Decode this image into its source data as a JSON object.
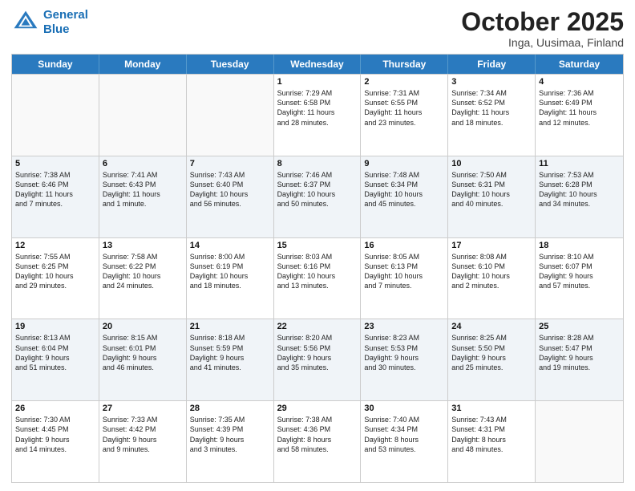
{
  "header": {
    "logo_line1": "General",
    "logo_line2": "Blue",
    "month": "October 2025",
    "location": "Inga, Uusimaa, Finland"
  },
  "weekdays": [
    "Sunday",
    "Monday",
    "Tuesday",
    "Wednesday",
    "Thursday",
    "Friday",
    "Saturday"
  ],
  "rows": [
    {
      "alt": false,
      "cells": [
        {
          "day": "",
          "info": ""
        },
        {
          "day": "",
          "info": ""
        },
        {
          "day": "",
          "info": ""
        },
        {
          "day": "1",
          "info": "Sunrise: 7:29 AM\nSunset: 6:58 PM\nDaylight: 11 hours\nand 28 minutes."
        },
        {
          "day": "2",
          "info": "Sunrise: 7:31 AM\nSunset: 6:55 PM\nDaylight: 11 hours\nand 23 minutes."
        },
        {
          "day": "3",
          "info": "Sunrise: 7:34 AM\nSunset: 6:52 PM\nDaylight: 11 hours\nand 18 minutes."
        },
        {
          "day": "4",
          "info": "Sunrise: 7:36 AM\nSunset: 6:49 PM\nDaylight: 11 hours\nand 12 minutes."
        }
      ]
    },
    {
      "alt": true,
      "cells": [
        {
          "day": "5",
          "info": "Sunrise: 7:38 AM\nSunset: 6:46 PM\nDaylight: 11 hours\nand 7 minutes."
        },
        {
          "day": "6",
          "info": "Sunrise: 7:41 AM\nSunset: 6:43 PM\nDaylight: 11 hours\nand 1 minute."
        },
        {
          "day": "7",
          "info": "Sunrise: 7:43 AM\nSunset: 6:40 PM\nDaylight: 10 hours\nand 56 minutes."
        },
        {
          "day": "8",
          "info": "Sunrise: 7:46 AM\nSunset: 6:37 PM\nDaylight: 10 hours\nand 50 minutes."
        },
        {
          "day": "9",
          "info": "Sunrise: 7:48 AM\nSunset: 6:34 PM\nDaylight: 10 hours\nand 45 minutes."
        },
        {
          "day": "10",
          "info": "Sunrise: 7:50 AM\nSunset: 6:31 PM\nDaylight: 10 hours\nand 40 minutes."
        },
        {
          "day": "11",
          "info": "Sunrise: 7:53 AM\nSunset: 6:28 PM\nDaylight: 10 hours\nand 34 minutes."
        }
      ]
    },
    {
      "alt": false,
      "cells": [
        {
          "day": "12",
          "info": "Sunrise: 7:55 AM\nSunset: 6:25 PM\nDaylight: 10 hours\nand 29 minutes."
        },
        {
          "day": "13",
          "info": "Sunrise: 7:58 AM\nSunset: 6:22 PM\nDaylight: 10 hours\nand 24 minutes."
        },
        {
          "day": "14",
          "info": "Sunrise: 8:00 AM\nSunset: 6:19 PM\nDaylight: 10 hours\nand 18 minutes."
        },
        {
          "day": "15",
          "info": "Sunrise: 8:03 AM\nSunset: 6:16 PM\nDaylight: 10 hours\nand 13 minutes."
        },
        {
          "day": "16",
          "info": "Sunrise: 8:05 AM\nSunset: 6:13 PM\nDaylight: 10 hours\nand 7 minutes."
        },
        {
          "day": "17",
          "info": "Sunrise: 8:08 AM\nSunset: 6:10 PM\nDaylight: 10 hours\nand 2 minutes."
        },
        {
          "day": "18",
          "info": "Sunrise: 8:10 AM\nSunset: 6:07 PM\nDaylight: 9 hours\nand 57 minutes."
        }
      ]
    },
    {
      "alt": true,
      "cells": [
        {
          "day": "19",
          "info": "Sunrise: 8:13 AM\nSunset: 6:04 PM\nDaylight: 9 hours\nand 51 minutes."
        },
        {
          "day": "20",
          "info": "Sunrise: 8:15 AM\nSunset: 6:01 PM\nDaylight: 9 hours\nand 46 minutes."
        },
        {
          "day": "21",
          "info": "Sunrise: 8:18 AM\nSunset: 5:59 PM\nDaylight: 9 hours\nand 41 minutes."
        },
        {
          "day": "22",
          "info": "Sunrise: 8:20 AM\nSunset: 5:56 PM\nDaylight: 9 hours\nand 35 minutes."
        },
        {
          "day": "23",
          "info": "Sunrise: 8:23 AM\nSunset: 5:53 PM\nDaylight: 9 hours\nand 30 minutes."
        },
        {
          "day": "24",
          "info": "Sunrise: 8:25 AM\nSunset: 5:50 PM\nDaylight: 9 hours\nand 25 minutes."
        },
        {
          "day": "25",
          "info": "Sunrise: 8:28 AM\nSunset: 5:47 PM\nDaylight: 9 hours\nand 19 minutes."
        }
      ]
    },
    {
      "alt": false,
      "cells": [
        {
          "day": "26",
          "info": "Sunrise: 7:30 AM\nSunset: 4:45 PM\nDaylight: 9 hours\nand 14 minutes."
        },
        {
          "day": "27",
          "info": "Sunrise: 7:33 AM\nSunset: 4:42 PM\nDaylight: 9 hours\nand 9 minutes."
        },
        {
          "day": "28",
          "info": "Sunrise: 7:35 AM\nSunset: 4:39 PM\nDaylight: 9 hours\nand 3 minutes."
        },
        {
          "day": "29",
          "info": "Sunrise: 7:38 AM\nSunset: 4:36 PM\nDaylight: 8 hours\nand 58 minutes."
        },
        {
          "day": "30",
          "info": "Sunrise: 7:40 AM\nSunset: 4:34 PM\nDaylight: 8 hours\nand 53 minutes."
        },
        {
          "day": "31",
          "info": "Sunrise: 7:43 AM\nSunset: 4:31 PM\nDaylight: 8 hours\nand 48 minutes."
        },
        {
          "day": "",
          "info": ""
        }
      ]
    }
  ]
}
